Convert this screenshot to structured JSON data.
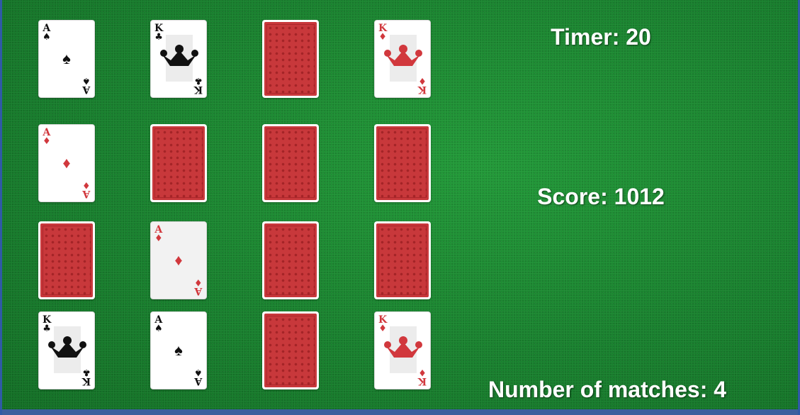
{
  "hud": {
    "timer": "Timer: 20",
    "score": "Score: 1012",
    "matches": "Number of matches: 4"
  },
  "colors": {
    "felt": "#16822a",
    "card_back": "#c8383b",
    "red_suit": "#d1383d",
    "black_suit": "#111111"
  },
  "cards": [
    {
      "rank": "A",
      "suit": "♠",
      "suit_name": "spades",
      "state": "face-up"
    },
    {
      "rank": "K",
      "suit": "♣",
      "suit_name": "clubs",
      "state": "face-up"
    },
    {
      "state": "face-down"
    },
    {
      "rank": "K",
      "suit": "♦",
      "suit_name": "diamonds",
      "state": "face-up"
    },
    {
      "rank": "A",
      "suit": "♦",
      "suit_name": "diamonds",
      "state": "face-up"
    },
    {
      "state": "face-down"
    },
    {
      "state": "face-down"
    },
    {
      "state": "face-down"
    },
    {
      "state": "face-down"
    },
    {
      "rank": "A",
      "suit": "♦",
      "suit_name": "diamonds",
      "state": "face-up"
    },
    {
      "state": "face-down"
    },
    {
      "state": "face-down"
    },
    {
      "rank": "K",
      "suit": "♣",
      "suit_name": "clubs",
      "state": "face-up"
    },
    {
      "rank": "A",
      "suit": "♠",
      "suit_name": "spades",
      "state": "face-up"
    },
    {
      "state": "face-down"
    },
    {
      "rank": "K",
      "suit": "♦",
      "suit_name": "diamonds",
      "state": "face-up"
    }
  ]
}
